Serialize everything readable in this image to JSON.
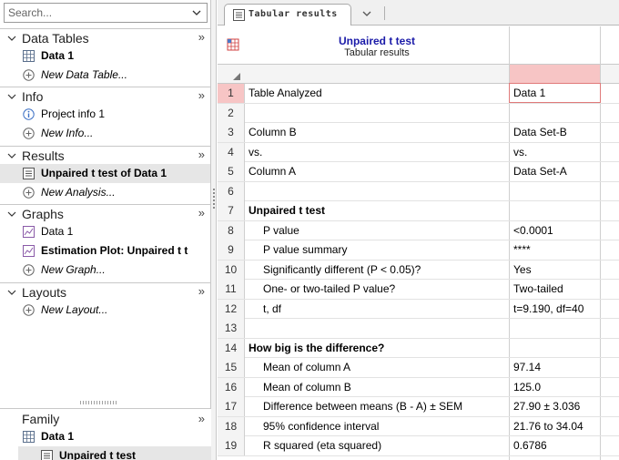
{
  "navigator": {
    "search_placeholder": "Search...",
    "sections": [
      {
        "title": "Data Tables",
        "items": [
          {
            "label": "Data 1",
            "icon": "data-table-icon",
            "style": "bold",
            "selected": false
          },
          {
            "label": "New Data Table...",
            "icon": "add-circle-icon",
            "style": "italic",
            "selected": false
          }
        ]
      },
      {
        "title": "Info",
        "items": [
          {
            "label": "Project info 1",
            "icon": "info-icon",
            "style": "normal",
            "selected": false
          },
          {
            "label": "New Info...",
            "icon": "add-circle-icon",
            "style": "italic",
            "selected": false
          }
        ]
      },
      {
        "title": "Results",
        "items": [
          {
            "label": "Unpaired t test of Data 1",
            "icon": "results-sheet-icon",
            "style": "bold",
            "selected": true
          },
          {
            "label": "New Analysis...",
            "icon": "add-circle-icon",
            "style": "italic",
            "selected": false
          }
        ]
      },
      {
        "title": "Graphs",
        "items": [
          {
            "label": "Data 1",
            "icon": "graph-icon",
            "style": "normal",
            "selected": false
          },
          {
            "label": "Estimation Plot: Unpaired t t",
            "icon": "graph-icon",
            "style": "bold",
            "selected": false
          },
          {
            "label": "New Graph...",
            "icon": "add-circle-icon",
            "style": "italic",
            "selected": false
          }
        ]
      },
      {
        "title": "Layouts",
        "items": [
          {
            "label": "New Layout...",
            "icon": "add-circle-icon",
            "style": "italic",
            "selected": false
          }
        ]
      }
    ],
    "family": {
      "title": "Family",
      "items": [
        {
          "label": "Data 1",
          "icon": "data-table-icon"
        },
        {
          "label": "Unpaired t test",
          "icon": "results-sheet-icon"
        }
      ]
    }
  },
  "tab": {
    "label": "Tabular results"
  },
  "sheet": {
    "title": "Unpaired t test",
    "subtitle": "Tabular results",
    "rows": [
      {
        "n": "1",
        "a": "Table Analyzed",
        "b": "Data 1",
        "indent": false,
        "bold": false
      },
      {
        "n": "2",
        "a": "",
        "b": "",
        "indent": false,
        "bold": false
      },
      {
        "n": "3",
        "a": "Column B",
        "b": "Data Set-B",
        "indent": false,
        "bold": false
      },
      {
        "n": "4",
        "a": "vs.",
        "b": "vs.",
        "indent": false,
        "bold": false
      },
      {
        "n": "5",
        "a": "Column A",
        "b": "Data Set-A",
        "indent": false,
        "bold": false
      },
      {
        "n": "6",
        "a": "",
        "b": "",
        "indent": false,
        "bold": false
      },
      {
        "n": "7",
        "a": "Unpaired t test",
        "b": "",
        "indent": false,
        "bold": true
      },
      {
        "n": "8",
        "a": "P value",
        "b": "<0.0001",
        "indent": true,
        "bold": false
      },
      {
        "n": "9",
        "a": "P value summary",
        "b": "****",
        "indent": true,
        "bold": false
      },
      {
        "n": "10",
        "a": "Significantly different (P < 0.05)?",
        "b": "Yes",
        "indent": true,
        "bold": false
      },
      {
        "n": "11",
        "a": "One- or two-tailed P value?",
        "b": "Two-tailed",
        "indent": true,
        "bold": false
      },
      {
        "n": "12",
        "a": "t, df",
        "b": "t=9.190, df=40",
        "indent": true,
        "bold": false
      },
      {
        "n": "13",
        "a": "",
        "b": "",
        "indent": false,
        "bold": false
      },
      {
        "n": "14",
        "a": "How big is the difference?",
        "b": "",
        "indent": false,
        "bold": true
      },
      {
        "n": "15",
        "a": "Mean of column A",
        "b": "97.14",
        "indent": true,
        "bold": false
      },
      {
        "n": "16",
        "a": "Mean of column B",
        "b": "125.0",
        "indent": true,
        "bold": false
      },
      {
        "n": "17",
        "a": "Difference between means (B - A) ± SEM",
        "b": "27.90 ± 3.036",
        "indent": true,
        "bold": false
      },
      {
        "n": "18",
        "a": "95% confidence interval",
        "b": "21.76 to 34.04",
        "indent": true,
        "bold": false
      },
      {
        "n": "19",
        "a": "R squared (eta squared)",
        "b": "0.6786",
        "indent": true,
        "bold": false
      }
    ],
    "selected_row": "1"
  },
  "colors": {
    "accent_title": "#1a1aa8",
    "selection_fill": "#f7c5c5",
    "selection_border": "#e07a7a"
  }
}
